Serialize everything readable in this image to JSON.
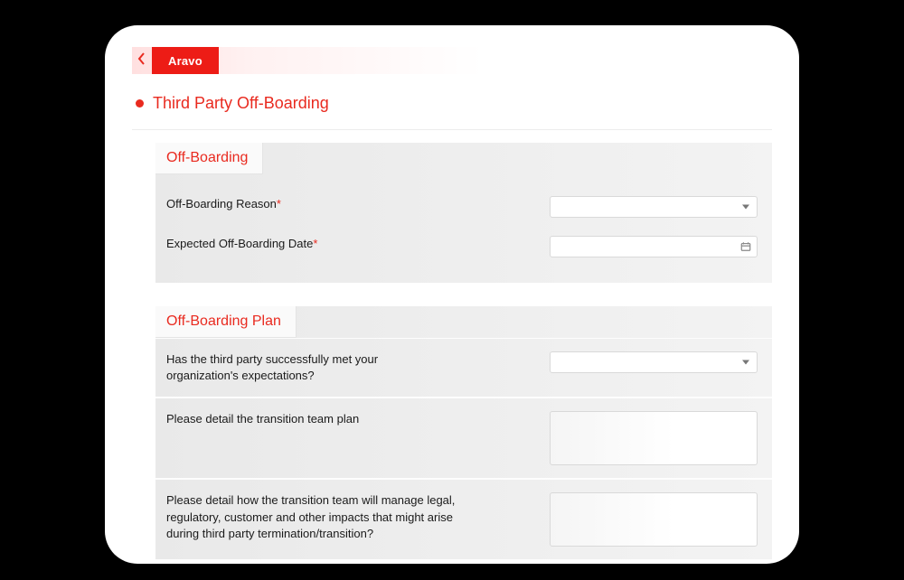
{
  "brand": "Aravo",
  "page_title": "Third Party Off-Boarding",
  "sections": {
    "offboarding": {
      "title": "Off-Boarding",
      "reason_label": "Off-Boarding Reason",
      "date_label": "Expected Off-Boarding Date"
    },
    "plan": {
      "title": "Off-Boarding Plan",
      "q_expectations": "Has the third party successfully met your organization's expectations?",
      "q_transition_plan": "Please detail the transition team plan",
      "q_impacts": "Please detail how the transition team will manage legal, regulatory, customer and other impacts that might arise during third party termination/transition?"
    }
  },
  "required_marker": "*"
}
